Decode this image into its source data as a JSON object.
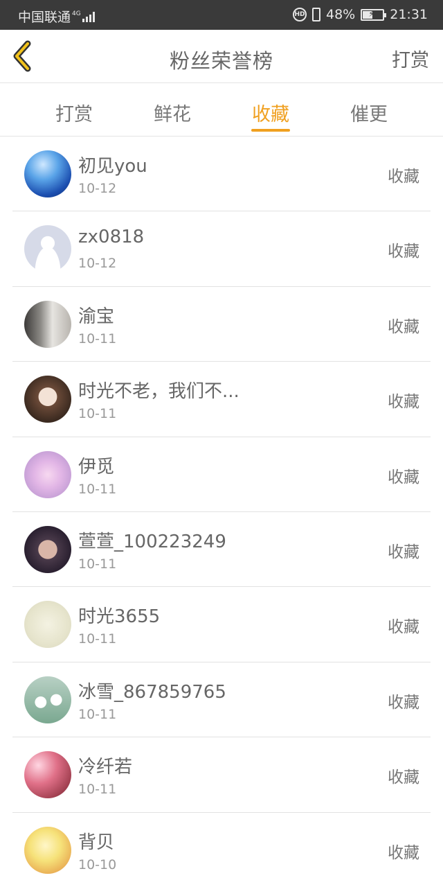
{
  "status_bar": {
    "carrier": "中国联通",
    "network": "4G",
    "battery_percent": "48%",
    "battery_level": 0.48,
    "time": "21:31"
  },
  "header": {
    "back_icon": "chevron-left-icon",
    "title": "粉丝荣誉榜",
    "action_label": "打赏"
  },
  "tabs": [
    {
      "label": "打赏",
      "active": false
    },
    {
      "label": "鲜花",
      "active": false
    },
    {
      "label": "收藏",
      "active": true
    },
    {
      "label": "催更",
      "active": false
    }
  ],
  "accent_color": "#f0a020",
  "list": [
    {
      "name": "初见you",
      "date": "10-12",
      "action": "收藏"
    },
    {
      "name": "zx0818",
      "date": "10-12",
      "action": "收藏"
    },
    {
      "name": "渝宝",
      "date": "10-11",
      "action": "收藏"
    },
    {
      "name": "时光不老，我们不...",
      "date": "10-11",
      "action": "收藏"
    },
    {
      "name": "伊觅",
      "date": "10-11",
      "action": "收藏"
    },
    {
      "name": "萱萱_100223249",
      "date": "10-11",
      "action": "收藏"
    },
    {
      "name": "时光3655",
      "date": "10-11",
      "action": "收藏"
    },
    {
      "name": "冰雪_867859765",
      "date": "10-11",
      "action": "收藏"
    },
    {
      "name": "冷纤若",
      "date": "10-11",
      "action": "收藏"
    },
    {
      "name": "背贝",
      "date": "10-10",
      "action": "收藏"
    }
  ]
}
